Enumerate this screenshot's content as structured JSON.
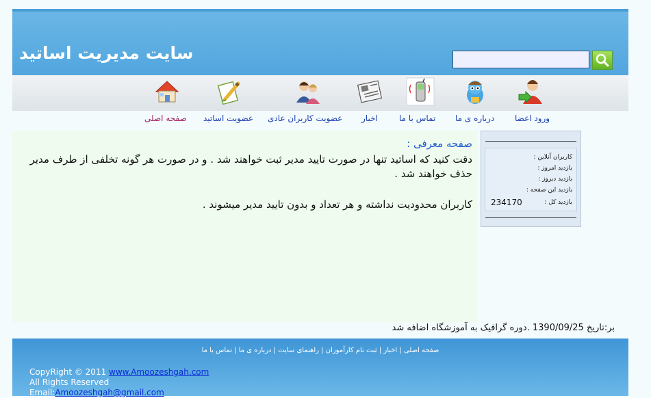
{
  "header": {
    "site_title": "سایت مدیریت اساتید",
    "search_placeholder": "",
    "search_value": ""
  },
  "nav": {
    "login": "ورود اعضا",
    "about": "درباره ی ما",
    "contact": "تماس با ما",
    "news": "اخبار",
    "user_membership": "عضویت کاربران عادی",
    "teacher_membership": "عضویت اساتید",
    "home": "صفحه اصلی"
  },
  "icons": {
    "login": "user-login-icon",
    "about": "cartoon-character-icon",
    "contact": "mobile-phone-icon",
    "news": "newspaper-icon",
    "user_membership": "users-icon",
    "teacher_membership": "pencil-paper-icon",
    "home": "house-icon"
  },
  "main": {
    "title": "صفحه معرفی :",
    "paragraph1": "دقت کنید که اساتید تنها در صورت تایید مدیر ثبت خواهند شد . و در صورت هر گونه تخلفی از طرف مدیر حذف خواهند شد .",
    "paragraph2": "کاربران محدودیت نداشته و هر تعداد و بدون تایید مدیر میشوند ."
  },
  "stats": {
    "online_label": "کاربران آنلاین :",
    "today_label": "بازدید امروز :",
    "yesterday_label": "بازدید دیروز :",
    "page_label": "بازدید این صفحه :",
    "total_label": "بازدید کل :",
    "total_value": "234170"
  },
  "dateline": "بر:تاریخ 1390/09/25 .دوره گرافیک به آموزشگاه اضافه شد",
  "footer": {
    "links": [
      "صفحه اصلی",
      "اخبار",
      "ثبت نام کارآموزان",
      "راهنمای سایت",
      "درباره ی ما",
      "تماس با ما"
    ],
    "separator": " | ",
    "copyright_prefix": "CopyRight © 2011 ",
    "site_link": "www.Amoozeshgah.com",
    "rights": "All Rights Reserved",
    "email_prefix": "Email:",
    "email": "Amoozeshgah@gmail.com"
  },
  "colors": {
    "header_blue": "#52a6de",
    "nav_link": "#1a3fae",
    "nav_home": "#a02060",
    "title_blue": "#1e5bd0",
    "main_bg": "#eefbee",
    "footer_blue": "#3f95d6"
  }
}
